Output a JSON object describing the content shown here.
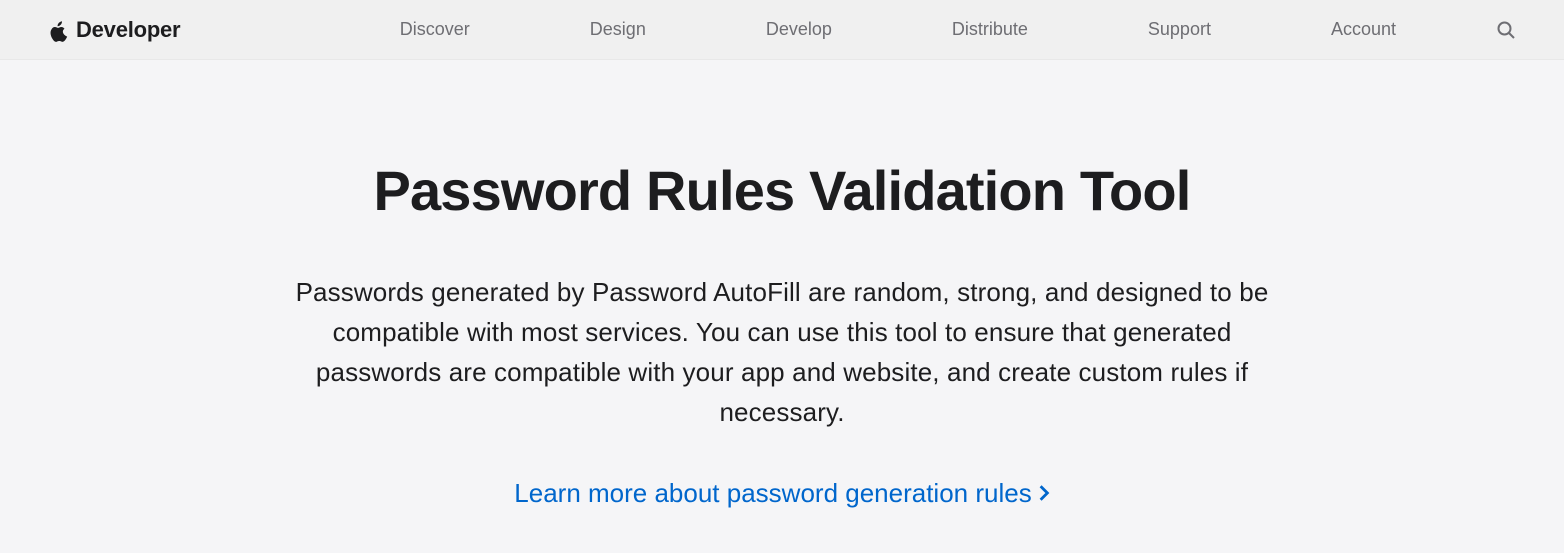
{
  "nav": {
    "brand": "Developer",
    "links": [
      "Discover",
      "Design",
      "Develop",
      "Distribute",
      "Support",
      "Account"
    ]
  },
  "main": {
    "title": "Password Rules Validation Tool",
    "description": "Passwords generated by Password AutoFill are random, strong, and designed to be compatible with most services. You can use this tool to ensure that generated passwords are compatible with your app and website, and create custom rules if necessary.",
    "link_text": "Learn more about password generation rules"
  }
}
